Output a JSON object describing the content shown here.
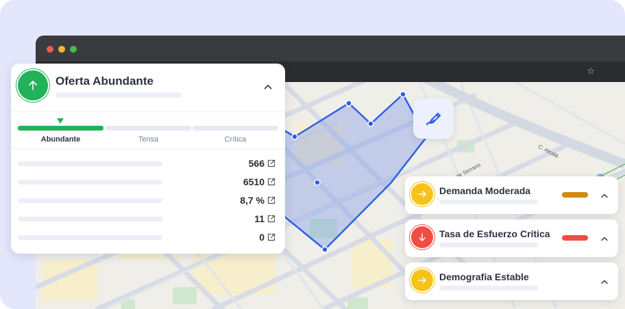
{
  "browser": {
    "bookmark_icon": "star-icon"
  },
  "map": {
    "street_labels": [
      "C. de Serrano",
      "C. Alcalá"
    ],
    "polygon_color": "#2d5ee6",
    "edit_icon": "pencil-icon"
  },
  "summary_panel": {
    "title": "Oferta Abundante",
    "status_icon": "arrow-up-icon",
    "status_color": "#22b25a",
    "scale": {
      "selected": "Abundante",
      "levels": [
        "Abundante",
        "Tensa",
        "Crítica"
      ]
    },
    "metrics": [
      {
        "value": "566"
      },
      {
        "value": "6510"
      },
      {
        "value": "8,7 %"
      },
      {
        "value": "11"
      },
      {
        "value": "0"
      }
    ]
  },
  "cards": [
    {
      "title": "Demanda Moderada",
      "icon": "arrow-right-icon",
      "icon_color": "#f7c21a",
      "indicator_color": "#d48a0e"
    },
    {
      "title": "Tasa de Esfuerzo Crítica",
      "icon": "arrow-down-icon",
      "icon_color": "#f24d43",
      "indicator_color": "#f24d43"
    },
    {
      "title": "Demografía Estable",
      "icon": "arrow-right-icon",
      "icon_color": "#f7c21a",
      "indicator_color": ""
    }
  ]
}
